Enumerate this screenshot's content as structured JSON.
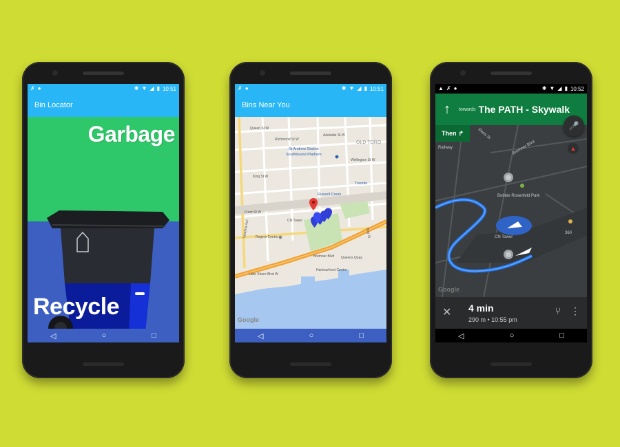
{
  "phones": [
    {
      "status_time": "10:51",
      "app_title": "Bin Locator",
      "label_top": "Garbage",
      "label_bottom": "Recycle"
    },
    {
      "status_time": "10:51",
      "app_title": "Bins Near You",
      "map_labels": [
        "Queen St W",
        "Richmond St W",
        "Adelaide St W",
        "St Andrew Station",
        "Southbound Platform",
        "King St W",
        "Wellington St W",
        "OLD TORO",
        "Toronto",
        "Russell Creek",
        "Front St W",
        "CN Tower",
        "Rogers Centre",
        "Bremner Blvd",
        "Queens Quay",
        "Harbourfront Centre",
        "Lake Shore Blvd W",
        "Spadina Ave",
        "Bay St"
      ],
      "map_credit": "Google"
    },
    {
      "status_time": "10:52",
      "maneuver_icon": "arrow-up-icon",
      "towards": "towards",
      "destination": "The PATH - Skywalk",
      "then_label": "Then",
      "map_labels": [
        "Bobbie Rosenfeld Park",
        "CN Tower",
        "Bremner Blvd",
        "Rees St",
        "Railway",
        "360"
      ],
      "map_credit": "Google",
      "eta_time": "4 min",
      "eta_sub": "290 m • 10:55 pm"
    }
  ],
  "nav_buttons": [
    "◁",
    "○",
    "□"
  ]
}
